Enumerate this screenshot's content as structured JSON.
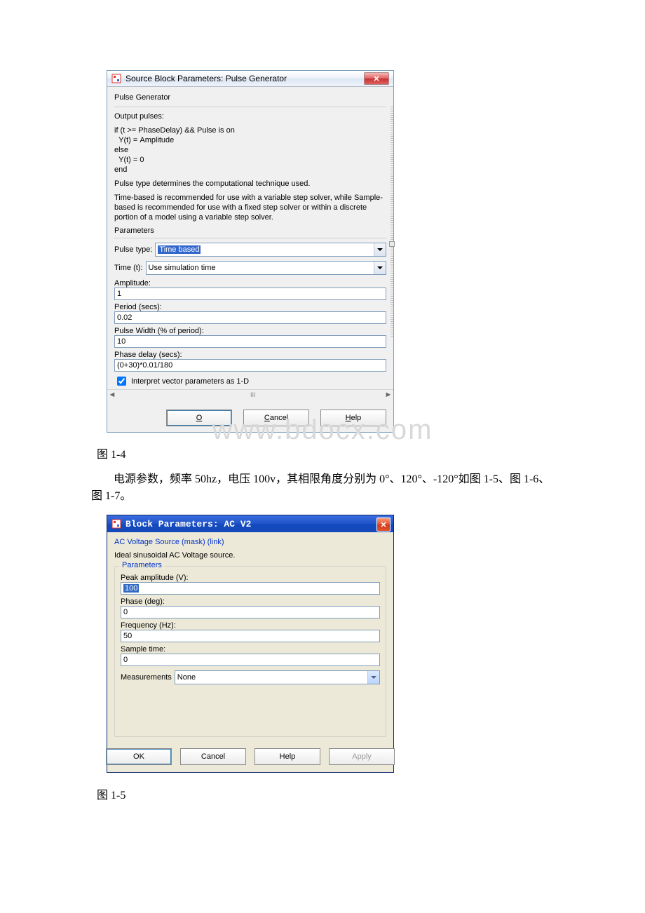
{
  "dialog1": {
    "title": "Source Block Parameters: Pulse Generator",
    "block_name": "Pulse Generator",
    "output_label": "Output pulses:",
    "code_lines": [
      "if (t >= PhaseDelay) && Pulse is on",
      "  Y(t) = Amplitude",
      "else",
      "  Y(t) = 0",
      "end"
    ],
    "desc1": "Pulse type determines the computational technique used.",
    "desc2": "Time-based is recommended for use with a variable step solver, while Sample-based is recommended for use with a fixed step solver or within a discrete portion of a model using a variable step solver.",
    "parameters_label": "Parameters",
    "pulse_type_label": "Pulse type:",
    "pulse_type_value": "Time based",
    "time_label": "Time (t):",
    "time_value": "Use simulation time",
    "amplitude_label": "Amplitude:",
    "amplitude_value": "1",
    "period_label": "Period (secs):",
    "period_value": "0.02",
    "pulse_width_label": "Pulse Width (% of period):",
    "pulse_width_value": "10",
    "phase_delay_label": "Phase delay (secs):",
    "phase_delay_value": "(0+30)*0.01/180",
    "interpret_label": "Interpret vector parameters as 1-D",
    "scroll_mark": "III",
    "ok": "OK",
    "cancel": "Cancel",
    "help": "Help"
  },
  "caption1": "图 1-4",
  "paragraph": "电源参数，频率 50hz，电压 100v，其相限角度分别为 0°、120°、-120°如图 1-5、图 1-6、图 1-7。",
  "dialog2": {
    "title": "Block Parameters: AC V2",
    "mask_link": "AC Voltage Source (mask) (link)",
    "mask_desc": "Ideal sinusoidal AC Voltage source.",
    "parameters_label": "Parameters",
    "peak_amp_label": "Peak amplitude (V):",
    "peak_amp_value": "100",
    "phase_label": "Phase (deg):",
    "phase_value": "0",
    "freq_label": "Frequency (Hz):",
    "freq_value": "50",
    "sample_label": "Sample time:",
    "sample_value": "0",
    "meas_label": "Measurements",
    "meas_value": "None",
    "ok": "OK",
    "cancel": "Cancel",
    "help": "Help",
    "apply": "Apply"
  },
  "caption2": "图 1-5",
  "watermark": "www.bdocx.com"
}
